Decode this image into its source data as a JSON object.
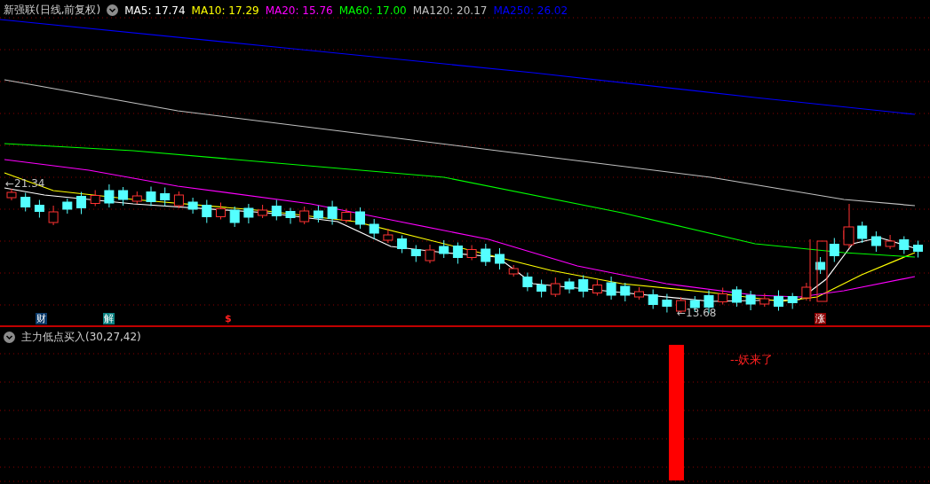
{
  "main_chart": {
    "title": "新强联(日线,前复权)",
    "ma_legend": [
      {
        "label": "MA5: 17.74",
        "color": "#ffffff"
      },
      {
        "label": "MA10: 17.29",
        "color": "#ffff00"
      },
      {
        "label": "MA20: 15.76",
        "color": "#ff00ff"
      },
      {
        "label": "MA60: 17.00",
        "color": "#00ff00"
      },
      {
        "label": "MA120: 20.17",
        "color": "#c0c0c0"
      },
      {
        "label": "MA250: 26.02",
        "color": "#0000ff"
      }
    ],
    "price_labels": [
      {
        "text": "←21.34"
      },
      {
        "text": "←13.68"
      }
    ],
    "markers": [
      {
        "text": "财",
        "kind": "finance"
      },
      {
        "text": "解",
        "kind": "unlock"
      },
      {
        "text": "$",
        "kind": "dollar"
      },
      {
        "text": "涨",
        "kind": "rise"
      }
    ]
  },
  "indicator": {
    "title": "主力低点买入(30,27,42)",
    "note": "--妖来了"
  }
}
